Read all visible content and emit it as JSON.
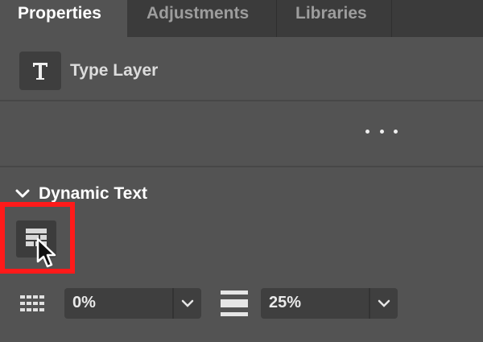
{
  "tabs": [
    {
      "label": "Properties",
      "active": true
    },
    {
      "label": "Adjustments",
      "active": false
    },
    {
      "label": "Libraries",
      "active": false
    }
  ],
  "layer": {
    "icon": "type-layer-icon",
    "icon_glyph": "T",
    "label": "Type Layer"
  },
  "more_menu_icon": "more-options-icon",
  "section": {
    "title": "Dynamic Text",
    "expanded": true,
    "button_icon": "dynamic-text-icon",
    "highlight_color": "#ff1a1a"
  },
  "controls": {
    "field1": {
      "icon": "grid-spacing-icon",
      "value": "0%"
    },
    "field2": {
      "icon": "line-spacing-icon",
      "value": "25%"
    }
  }
}
